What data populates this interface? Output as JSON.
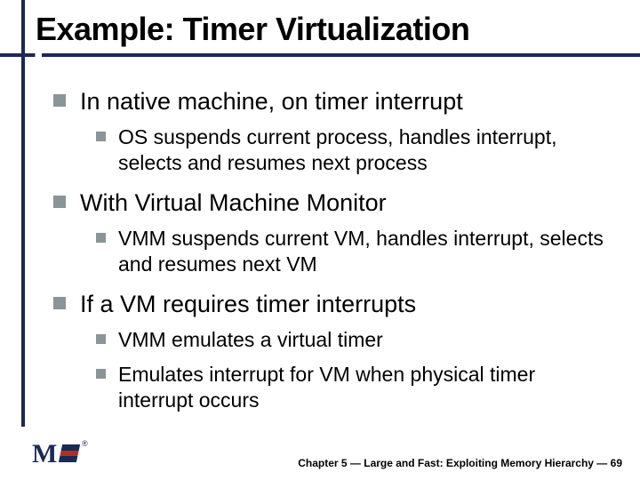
{
  "title": "Example: Timer Virtualization",
  "bullets": {
    "b1": "In native machine, on timer interrupt",
    "b1_1": "OS suspends current process, handles interrupt, selects and resumes next process",
    "b2": "With Virtual Machine Monitor",
    "b2_1": "VMM suspends current VM, handles interrupt, selects and resumes next VM",
    "b3": "If a VM requires timer interrupts",
    "b3_1": "VMM emulates a virtual timer",
    "b3_2": "Emulates interrupt for VM when physical timer interrupt occurs"
  },
  "footer": "Chapter 5 — Large and Fast: Exploiting Memory Hierarchy — 69",
  "logo_letter": "M",
  "logo_reg": "®"
}
